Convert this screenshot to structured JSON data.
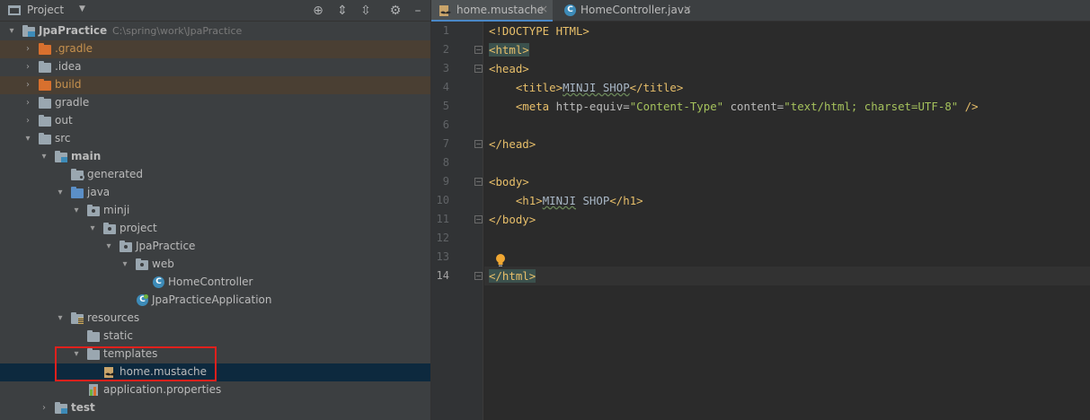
{
  "project_panel": {
    "title": "Project",
    "tree": [
      {
        "label": "JpaPractice",
        "path": "C:\\spring\\work\\JpaPractice",
        "arrow": "▾",
        "icon": "project-folder-icon",
        "bold": true
      },
      {
        "label": ".gradle",
        "arrow": "›",
        "icon": "excluded-folder-icon",
        "excluded": true
      },
      {
        "label": ".idea",
        "arrow": "›",
        "icon": "folder-icon"
      },
      {
        "label": "build",
        "arrow": "›",
        "icon": "excluded-folder-icon",
        "excluded": true
      },
      {
        "label": "gradle",
        "arrow": "›",
        "icon": "folder-icon"
      },
      {
        "label": "out",
        "arrow": "›",
        "icon": "folder-icon"
      },
      {
        "label": "src",
        "arrow": "▾",
        "icon": "folder-icon"
      },
      {
        "label": "main",
        "arrow": "▾",
        "icon": "module-folder-icon",
        "bold": true
      },
      {
        "label": "generated",
        "arrow": "",
        "icon": "generated-folder-icon"
      },
      {
        "label": "java",
        "arrow": "▾",
        "icon": "source-folder-icon"
      },
      {
        "label": "minji",
        "arrow": "▾",
        "icon": "package-icon"
      },
      {
        "label": "project",
        "arrow": "▾",
        "icon": "package-icon"
      },
      {
        "label": "JpaPractice",
        "arrow": "▾",
        "icon": "package-icon"
      },
      {
        "label": "web",
        "arrow": "▾",
        "icon": "package-icon"
      },
      {
        "label": "HomeController",
        "arrow": "",
        "icon": "class-icon"
      },
      {
        "label": "JpaPracticeApplication",
        "arrow": "",
        "icon": "spring-class-icon"
      },
      {
        "label": "resources",
        "arrow": "▾",
        "icon": "resources-folder-icon"
      },
      {
        "label": "static",
        "arrow": "",
        "icon": "folder-icon"
      },
      {
        "label": "templates",
        "arrow": "▾",
        "icon": "folder-icon"
      },
      {
        "label": "home.mustache",
        "arrow": "",
        "icon": "mustache-file-icon",
        "selected": true
      },
      {
        "label": "application.properties",
        "arrow": "",
        "icon": "properties-file-icon"
      },
      {
        "label": "test",
        "arrow": "›",
        "icon": "module-folder-icon",
        "bold": true
      }
    ]
  },
  "editor": {
    "tabs": [
      {
        "label": "home.mustache",
        "close": "×",
        "active": true
      },
      {
        "label": "HomeController.java",
        "close": "×",
        "active": false
      }
    ],
    "line_numbers": [
      "1",
      "2",
      "3",
      "4",
      "5",
      "6",
      "7",
      "8",
      "9",
      "10",
      "11",
      "12",
      "13",
      "14"
    ],
    "current_line": "14",
    "code": {
      "l1": "<!DOCTYPE HTML>",
      "l2": "<html>",
      "l3": "<head>",
      "l4_open": "<title>",
      "l4_text": "MINJI SHOP",
      "l4_close": "</title>",
      "l5_tag": "<meta",
      "l5_attr1": "http-equiv=",
      "l5_val1": "\"Content-Type\"",
      "l5_attr2": "content=",
      "l5_val2": "\"text/html; charset=UTF-8\"",
      "l5_end": "/>",
      "l7": "</head>",
      "l9": "<body>",
      "l10_open": "<h1>",
      "l10_word1": "MINJI",
      "l10_word2": " SHOP",
      "l10_close": "</h1>",
      "l11": "</body>",
      "l14": "</html>"
    }
  },
  "colors": {
    "panel_bg": "#3c3f41",
    "editor_bg": "#2b2b2b",
    "selection": "#0d293e",
    "excluded": "#4a3f33",
    "tag": "#e8bf6a",
    "string": "#a5c25c",
    "highlight_box": "#e0201c"
  }
}
